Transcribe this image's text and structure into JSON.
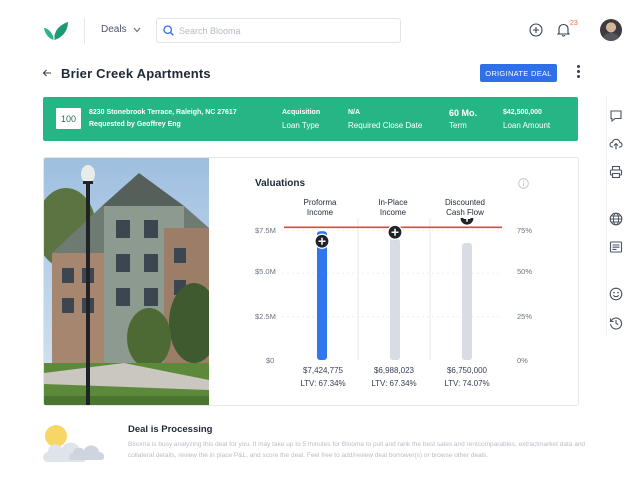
{
  "topbar": {
    "logo_icon": "leaf-logo-icon",
    "deals_label": "Deals",
    "search_placeholder": "Search Blooma",
    "notification_count": "23",
    "accent": "#2f6fe8"
  },
  "title_row": {
    "back_icon": "arrow-left-icon",
    "title": "Brier Creek Apartments",
    "originate_label": "ORIGINATE DEAL"
  },
  "summary": {
    "color": "#26b585",
    "id": "100",
    "address": "8230 Stonebrook Terrace, Raleigh, NC 27617",
    "requested_by": "Requested by Geoffrey Eng",
    "loan_type_value": "Acquisition",
    "loan_type_label": "Loan Type",
    "close_date_value": "N/A",
    "close_date_label": "Required Close Date",
    "term_value": "60 Mo.",
    "term_label": "Term",
    "loan_amount_value": "$42,500,000",
    "loan_amount_label": "Loan Amount"
  },
  "rail_icons": [
    "comment-icon",
    "cloud-upload-icon",
    "printer-icon",
    "globe-icon",
    "id-card-icon",
    "smiley-icon",
    "history-icon"
  ],
  "valuations": {
    "title": "Valuations",
    "info_icon": "info-icon",
    "columns": [
      {
        "line1": "Proforma",
        "line2": "Income",
        "value": "$7,424,775",
        "ltv": "LTV: 67.34%"
      },
      {
        "line1": "In-Place",
        "line2": "Income",
        "value": "$6,988,023",
        "ltv": "LTV: 67.34%"
      },
      {
        "line1": "Discounted",
        "line2": "Cash Flow",
        "value": "$6,750,000",
        "ltv": "LTV: 74.07%"
      }
    ],
    "left_axis": [
      "$7.5M",
      "$5.0M",
      "$2.5M",
      "$0"
    ],
    "right_axis": [
      "75%",
      "50%",
      "25%",
      "0%"
    ]
  },
  "chart_data": {
    "type": "bar",
    "categories": [
      "Proforma Income",
      "In-Place Income",
      "Discounted Cash Flow"
    ],
    "values": [
      7424775,
      6988023,
      6750000
    ],
    "ltv_percent": [
      67.34,
      67.34,
      74.07
    ],
    "ylim": [
      0,
      7500000
    ],
    "y2lim": [
      0,
      75
    ],
    "highlight_index": 0,
    "colors": {
      "highlight": "#2f76f0",
      "bar": "#d7dce5",
      "ltv_line": "#e0463f"
    }
  },
  "processing": {
    "title": "Deal is Processing",
    "body": "Blooma is busy analyzing this deal for you. It may take up to 5 minutes for Blooma to pull and rank the best sales and rentcomparables, extractmarket data and collateral details, review the in place P&L, and score the deal. Feel free to add/review deal borrower(s) or browse other  deals."
  }
}
